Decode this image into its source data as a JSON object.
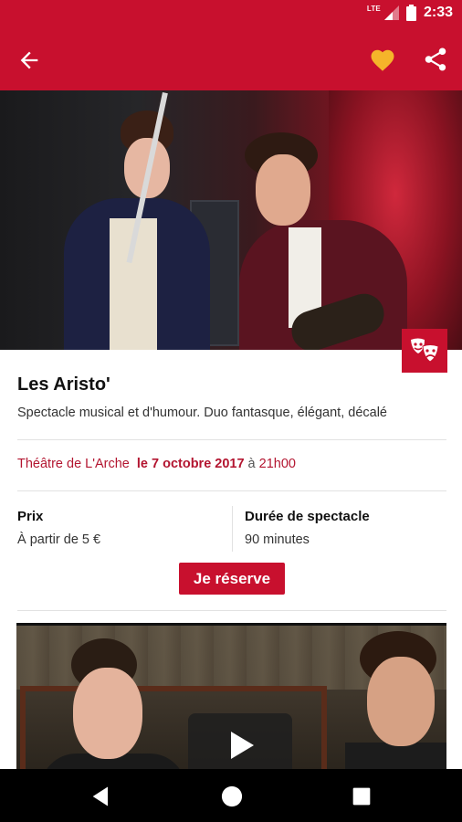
{
  "status_bar": {
    "network": "LTE",
    "time": "2:33"
  },
  "app_bar": {
    "back_icon": "arrow-back-icon",
    "favorite_icon": "heart-icon",
    "favorite_color": "#f5b42a",
    "share_icon": "share-icon",
    "background": "#c8102e"
  },
  "carousel": {
    "pages": 3,
    "active_page": 1,
    "category_icon": "theatre-masks-icon"
  },
  "event": {
    "title": "Les Aristo'",
    "description": "Spectacle musical et d'humour. Duo fantasque, élégant, décalé",
    "venue": "Théâtre de L'Arche",
    "date": "le 7 octobre 2017",
    "at": "à",
    "time": "21h00"
  },
  "price": {
    "label": "Prix",
    "value": "À partir de 5 €"
  },
  "duration": {
    "label": "Durée de spectacle",
    "value": "90 minutes"
  },
  "reserve_button": {
    "label": "Je réserve"
  },
  "video": {
    "play_icon": "play-icon"
  },
  "nav_bar": {
    "back_icon": "nav-back-icon",
    "home_icon": "nav-home-icon",
    "recents_icon": "nav-recents-icon"
  }
}
